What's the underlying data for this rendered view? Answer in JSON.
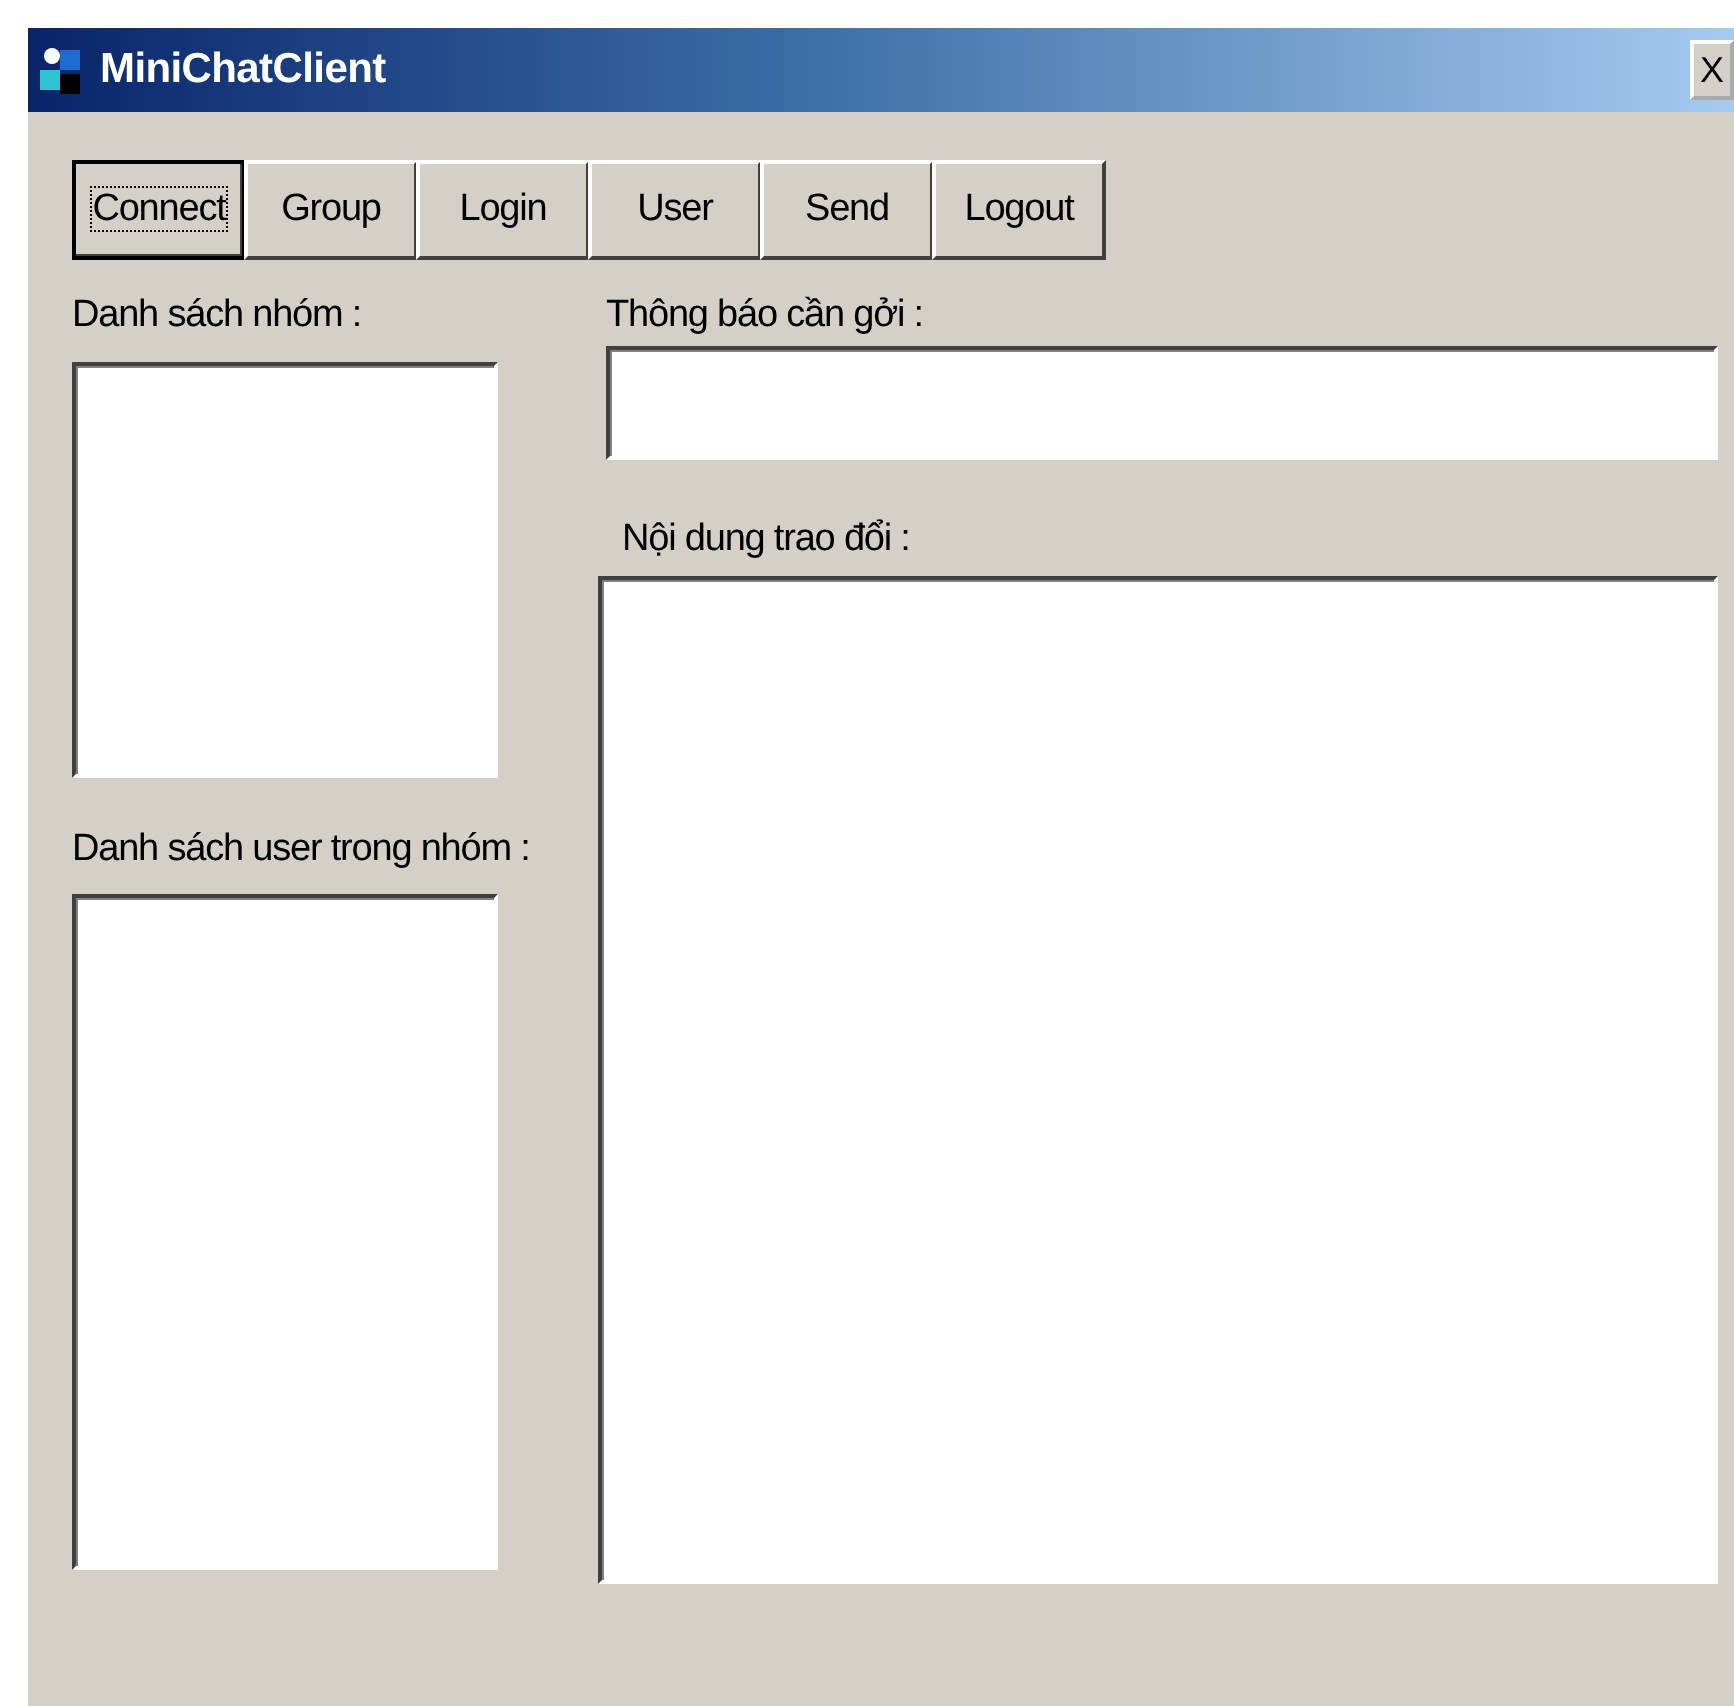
{
  "window": {
    "title": "MiniChatClient",
    "close": "X"
  },
  "toolbar": [
    {
      "label": "Connect",
      "focused": true
    },
    {
      "label": "Group",
      "focused": false
    },
    {
      "label": "Login",
      "focused": false
    },
    {
      "label": "User",
      "focused": false
    },
    {
      "label": "Send",
      "focused": false
    },
    {
      "label": "Logout",
      "focused": false
    }
  ],
  "group_list": {
    "label": "Danh sách nhóm :"
  },
  "user_list": {
    "label": "Danh sách user trong nhóm :"
  },
  "message": {
    "label": "Thông báo cần gởi :"
  },
  "conversation": {
    "label": "Nội dung trao đổi :"
  }
}
